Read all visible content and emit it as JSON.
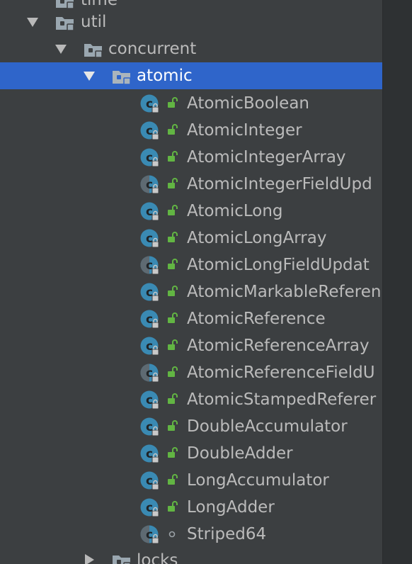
{
  "tree": {
    "packages": {
      "time": "time",
      "util": "util",
      "concurrent": "concurrent",
      "atomic": "atomic",
      "locks": "locks"
    },
    "classes": [
      {
        "name": "AtomicBoolean",
        "kind": "class",
        "access": "public"
      },
      {
        "name": "AtomicInteger",
        "kind": "class",
        "access": "public"
      },
      {
        "name": "AtomicIntegerArray",
        "kind": "class",
        "access": "public"
      },
      {
        "name": "AtomicIntegerFieldUpd",
        "kind": "abstract-class",
        "access": "public"
      },
      {
        "name": "AtomicLong",
        "kind": "class",
        "access": "public"
      },
      {
        "name": "AtomicLongArray",
        "kind": "class",
        "access": "public"
      },
      {
        "name": "AtomicLongFieldUpdat",
        "kind": "abstract-class",
        "access": "public"
      },
      {
        "name": "AtomicMarkableReferen",
        "kind": "class",
        "access": "public"
      },
      {
        "name": "AtomicReference",
        "kind": "class",
        "access": "public"
      },
      {
        "name": "AtomicReferenceArray",
        "kind": "class",
        "access": "public"
      },
      {
        "name": "AtomicReferenceFieldU",
        "kind": "abstract-class",
        "access": "public"
      },
      {
        "name": "AtomicStampedReferer",
        "kind": "class",
        "access": "public"
      },
      {
        "name": "DoubleAccumulator",
        "kind": "class",
        "access": "public"
      },
      {
        "name": "DoubleAdder",
        "kind": "class",
        "access": "public"
      },
      {
        "name": "LongAccumulator",
        "kind": "class",
        "access": "public"
      },
      {
        "name": "LongAdder",
        "kind": "class",
        "access": "public"
      },
      {
        "name": "Striped64",
        "kind": "abstract-class",
        "access": "package-private"
      }
    ]
  },
  "colors": {
    "background": "#3c3f41",
    "selection": "#2f65ca",
    "text": "#bbbbbb",
    "selected_text": "#ffffff",
    "class_icon": "#3a8ab3",
    "public_lock": "#62b543",
    "folder": "#9aa7b0"
  }
}
